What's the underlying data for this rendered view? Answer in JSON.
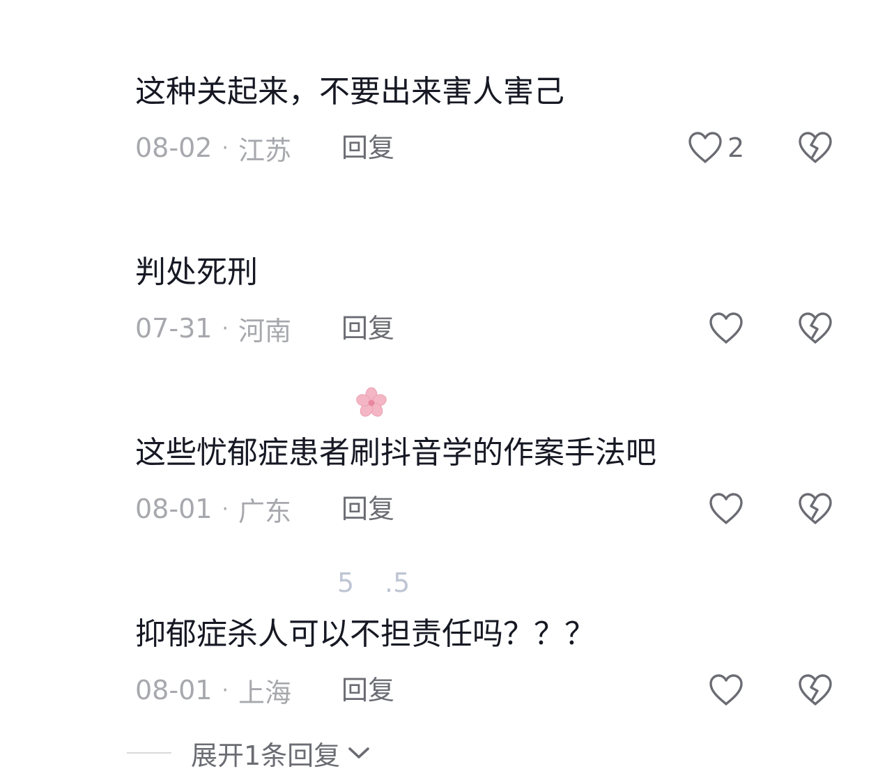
{
  "comments": [
    {
      "text": "这种关起来，不要出来害人害己",
      "date": "08-02",
      "sep": "·",
      "region": "江苏",
      "reply": "回复",
      "likes": "2"
    },
    {
      "text": "判处死刑",
      "date": "07-31",
      "sep": "·",
      "region": "河南",
      "reply": "回复",
      "likes": ""
    },
    {
      "text": "这些忧郁症患者刷抖音学的作案手法吧",
      "date": "08-01",
      "sep": "·",
      "region": "广东",
      "reply": "回复",
      "likes": ""
    },
    {
      "text": "抑郁症杀人可以不担责任吗？？？",
      "date": "08-01",
      "sep": "·",
      "region": "上海",
      "reply": "回复",
      "likes": ""
    }
  ],
  "stickers": {
    "a": "5",
    "b": ".5"
  },
  "expand": {
    "label": "展开1条回复"
  },
  "colors": {
    "text": "#161823",
    "meta": "#a7a8ad",
    "action": "#6b6c73",
    "flower": "#f4b6c4"
  },
  "icons": [
    "heart-icon",
    "broken-heart-icon",
    "flower-icon",
    "chevron-down-icon"
  ]
}
